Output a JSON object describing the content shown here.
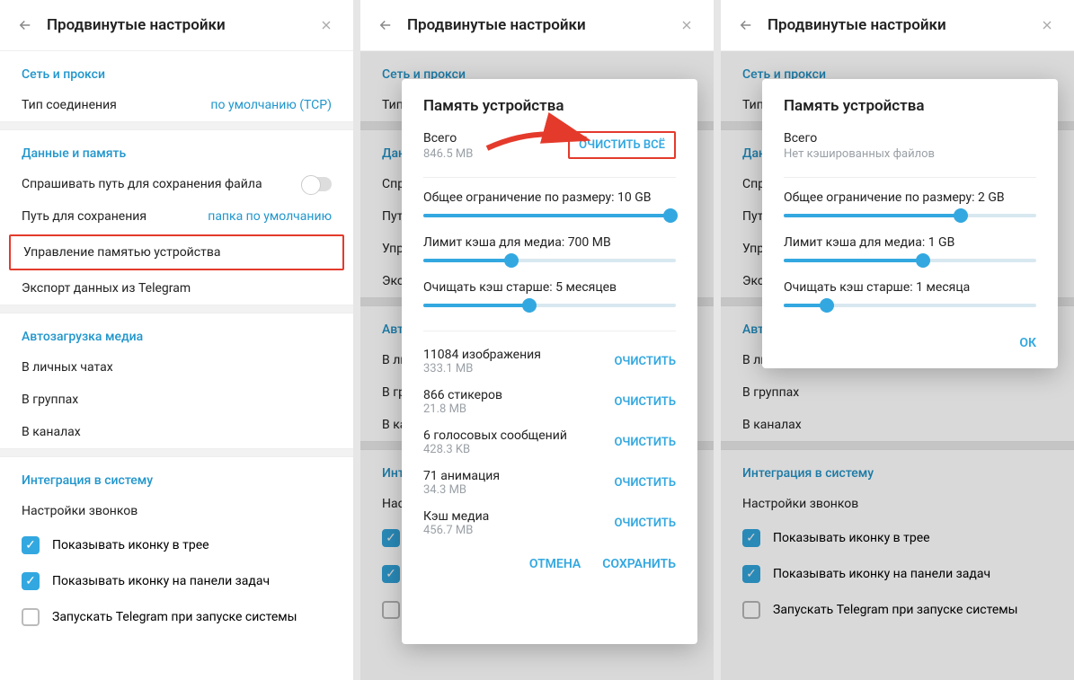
{
  "header": {
    "title": "Продвинутые настройки"
  },
  "sections": {
    "net": {
      "label": "Сеть и прокси",
      "conn_type": "Тип соединения",
      "conn_value": "по умолчанию (TCP)"
    },
    "data": {
      "label": "Данные и память",
      "ask_path": "Спрашивать путь для сохранения файла",
      "save_path": "Путь для сохранения",
      "save_path_value": "папка по умолчанию",
      "manage_storage": "Управление памятью устройства",
      "export": "Экспорт данных из Telegram"
    },
    "autoload": {
      "label": "Автозагрузка медиа",
      "private": "В личных чатах",
      "groups": "В группах",
      "channels": "В каналах"
    },
    "system": {
      "label": "Интеграция в систему",
      "call_settings": "Настройки звонков",
      "tray_icon": "Показывать иконку в трее",
      "taskbar_icon": "Показывать иконку на панели задач",
      "launch_startup": "Запускать Telegram при запуске системы"
    }
  },
  "modal2": {
    "title": "Память устройства",
    "total_label": "Всего",
    "total_value": "846.5 MB",
    "clear_all": "ОЧИСТИТЬ ВСЁ",
    "size_limit_label": "Общее ограничение по размеру: 10 GB",
    "media_cache_label": "Лимит кэша для медиа: 700 MB",
    "clear_older_label": "Очищать кэш старше: 5 месяцев",
    "items": [
      {
        "count": "11084 изображения",
        "size": "333.1 MB"
      },
      {
        "count": "866 стикеров",
        "size": "21.8 MB"
      },
      {
        "count": "6 голосовых сообщений",
        "size": "428.3 KB"
      },
      {
        "count": "71 анимация",
        "size": "34.3 MB"
      },
      {
        "count": "Кэш медиа",
        "size": "456.7 MB"
      }
    ],
    "clear": "ОЧИСТИТЬ",
    "cancel": "ОТМЕНА",
    "save": "СОХРАНИТЬ"
  },
  "modal3": {
    "title": "Память устройства",
    "total_label": "Всего",
    "total_value": "Нет кэшированных файлов",
    "size_limit_label": "Общее ограничение по размеру: 2 GB",
    "media_cache_label": "Лимит кэша для медиа: 1 GB",
    "clear_older_label": "Очищать кэш старше: 1 месяца",
    "ok": "ОК"
  },
  "sliders": {
    "p2_size": 98,
    "p2_media": 35,
    "p2_age": 42,
    "p3_size": 70,
    "p3_media": 55,
    "p3_age": 17
  }
}
